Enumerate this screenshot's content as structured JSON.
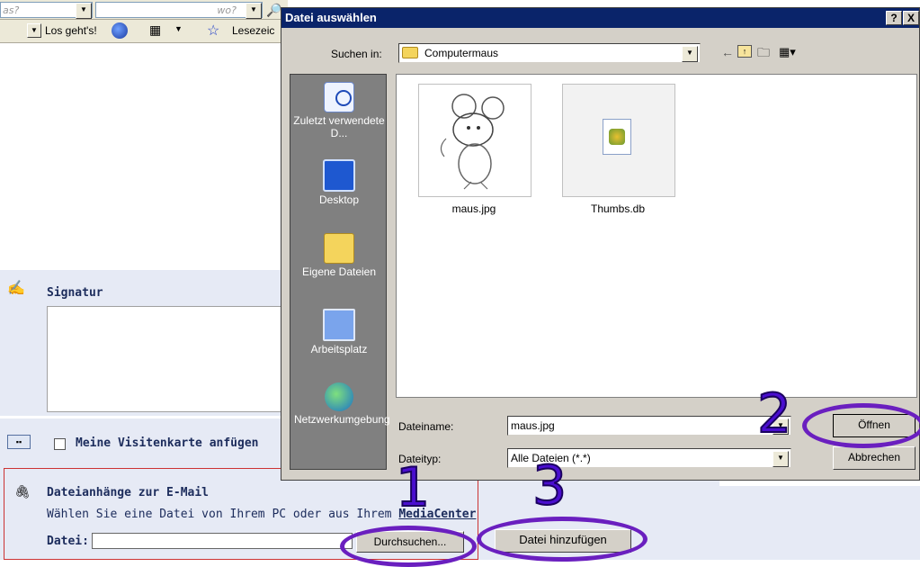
{
  "browser": {
    "search_placeholder_what": "as?",
    "search_placeholder_where": "wo?",
    "go_label": "Los geht's!",
    "bookmarks_label": "Lesezeic"
  },
  "mail": {
    "signature_title": "Signatur",
    "vcard_label": "Meine Visitenkarte anfügen",
    "attachments_title": "Dateianhänge zur E-Mail",
    "attachments_hint_prefix": "Wählen Sie eine Datei von Ihrem PC oder aus Ihrem ",
    "attachments_hint_link": "MediaCenter",
    "file_label": "Datei:",
    "file_value": "",
    "browse_button": "Durchsuchen...",
    "add_file_button": "Datei hinzufügen"
  },
  "dialog": {
    "title": "Datei auswählen",
    "help_btn": "?",
    "close_btn": "X",
    "look_in_label": "Suchen in:",
    "look_in_value": "Computermaus",
    "places": [
      {
        "label": "Zuletzt verwendete D...",
        "icon": "recent-icon"
      },
      {
        "label": "Desktop",
        "icon": "desktop-icon"
      },
      {
        "label": "Eigene Dateien",
        "icon": "my-documents-icon"
      },
      {
        "label": "Arbeitsplatz",
        "icon": "my-computer-icon"
      },
      {
        "label": "Netzwerkumgebung",
        "icon": "network-icon"
      }
    ],
    "files": [
      {
        "name": "maus.jpg"
      },
      {
        "name": "Thumbs.db"
      }
    ],
    "filename_label": "Dateiname:",
    "filename_value": "maus.jpg",
    "filetype_label": "Dateityp:",
    "filetype_value": "Alle Dateien (*.*)",
    "open_button": "Öffnen",
    "cancel_button": "Abbrechen"
  },
  "annotations": {
    "step1": "1",
    "step2": "2",
    "step3": "3",
    "color": "#6a1fbf"
  }
}
